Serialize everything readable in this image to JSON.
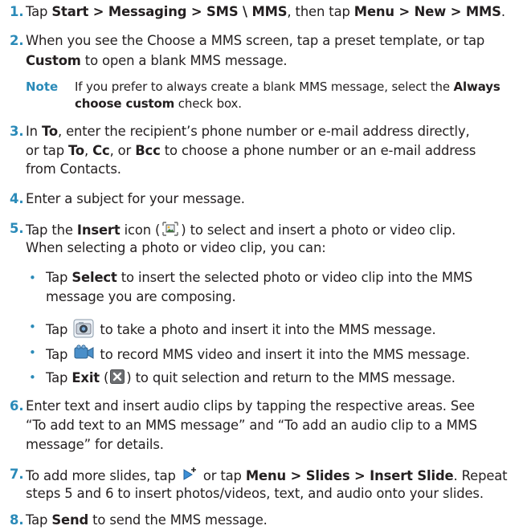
{
  "colors": {
    "accent": "#2a8ab8",
    "text": "#231f20"
  },
  "steps": [
    {
      "num": "1.",
      "s0": "Tap ",
      "b0": "Start > Messaging > SMS \\ MMS",
      "s1": ", then tap ",
      "b1": "Menu > New > MMS",
      "s2": "."
    },
    {
      "num": "2.",
      "l1": "When you see the Choose a MMS screen, tap a preset template, or tap",
      "b0": "Custom",
      "s1": " to open a blank MMS message.",
      "note": {
        "label": "Note",
        "t0": "If you prefer to always create a blank MMS message, select the ",
        "b0": "Always",
        "b1": "choose custom",
        "t1": " check box."
      }
    },
    {
      "num": "3.",
      "s0": "In ",
      "b0": "To",
      "s1": ", enter the recipient’s phone number or e-mail address directly,",
      "s2": "or tap ",
      "b1": "To",
      "s3": ", ",
      "b2": "Cc",
      "s4": ", or ",
      "b3": "Bcc",
      "s5": " to choose a phone number or an e-mail address",
      "l3": "from Contacts."
    },
    {
      "num": "4.",
      "text": "Enter a subject for your message."
    },
    {
      "num": "5.",
      "s0": "Tap the ",
      "b0": "Insert",
      "s1": " icon (",
      "icon": "insert-media-icon",
      "s2": ") to select and insert a photo or video clip.",
      "l2": "When selecting a photo or video clip, you can:",
      "bullets": [
        {
          "s0": "Tap ",
          "b0": "Select",
          "s1": " to insert the selected photo or video clip into the MMS",
          "l2": "message you are composing."
        },
        {
          "s0": "Tap ",
          "icon": "camera-icon",
          "s1": " to take a photo and insert it into the MMS message."
        },
        {
          "s0": "Tap ",
          "icon": "video-camera-icon",
          "s1": " to record MMS video and insert it into the MMS message."
        },
        {
          "s0": "Tap ",
          "b0": "Exit",
          "s1": " (",
          "icon": "exit-close-icon",
          "s2": ") to quit selection and return to the MMS message."
        }
      ]
    },
    {
      "num": "6.",
      "l1": "Enter text and insert audio clips by tapping the respective areas. See",
      "l2": "“To add text to an MMS message” and “To add an audio clip to a MMS",
      "l3": "message” for details."
    },
    {
      "num": "7.",
      "s0": "To add more slides, tap ",
      "icon": "add-slide-icon",
      "s1": " or tap ",
      "b0": "Menu > Slides > Insert Slide",
      "s2": ". Repeat",
      "l2": "steps 5 and 6 to insert photos/videos, text, and audio onto your slides."
    },
    {
      "num": "8.",
      "s0": "Tap ",
      "b0": "Send",
      "s1": " to send the MMS message."
    }
  ]
}
